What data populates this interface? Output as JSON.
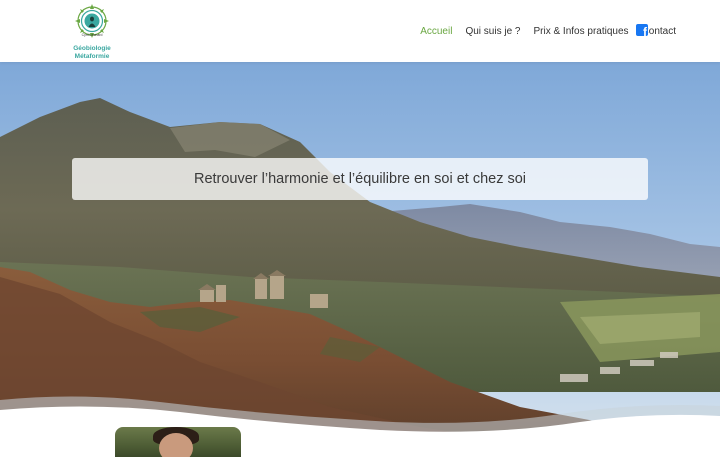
{
  "logo": {
    "tiny_text": "Cyril Leonard",
    "line1": "Géobiologie",
    "line2": "Métaformie"
  },
  "nav": {
    "items": [
      {
        "label": "Accueil",
        "active": true
      },
      {
        "label": "Qui suis je ?",
        "active": false
      },
      {
        "label": "Prix & Infos pratiques",
        "active": false
      },
      {
        "label": "Contact",
        "active": false
      }
    ],
    "social_icon": "facebook-icon",
    "active_color": "#6aa742"
  },
  "hero": {
    "tagline": "Retrouver l’harmonie et l’équilibre en soi et chez soi"
  }
}
